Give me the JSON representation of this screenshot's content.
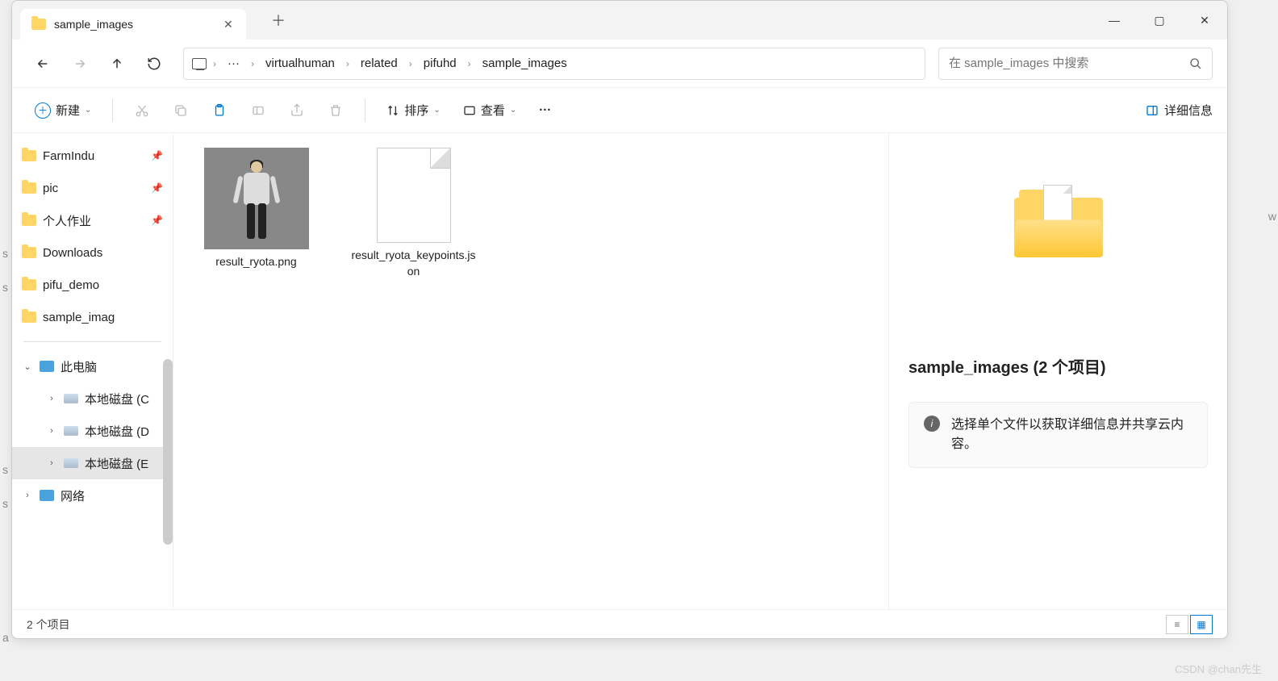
{
  "tab": {
    "title": "sample_images"
  },
  "window_controls": {
    "min": "—",
    "max": "▢",
    "close": "✕"
  },
  "breadcrumb": {
    "segments": [
      "virtualhuman",
      "related",
      "pifuhd",
      "sample_images"
    ],
    "ellipsis": "···"
  },
  "search": {
    "placeholder": "在 sample_images 中搜索"
  },
  "toolbar": {
    "new": "新建",
    "sort": "排序",
    "view": "查看",
    "more": "···",
    "details": "详细信息"
  },
  "sidebar": {
    "quick": [
      {
        "label": "FarmIndu",
        "pinned": true
      },
      {
        "label": "pic",
        "pinned": true
      },
      {
        "label": "个人作业",
        "pinned": true
      },
      {
        "label": "Downloads",
        "pinned": false
      },
      {
        "label": "pifu_demo",
        "pinned": false
      },
      {
        "label": "sample_imag",
        "pinned": false
      }
    ],
    "this_pc": "此电脑",
    "drives": [
      {
        "label": "本地磁盘 (C"
      },
      {
        "label": "本地磁盘 (D"
      },
      {
        "label": "本地磁盘 (E"
      }
    ],
    "network": "网络"
  },
  "files": [
    {
      "name": "result_ryota.png",
      "type": "image"
    },
    {
      "name": "result_ryota_keypoints.json",
      "type": "doc"
    }
  ],
  "details_pane": {
    "title": "sample_images (2 个项目)",
    "hint": "选择单个文件以获取详细信息并共享云内容。"
  },
  "statusbar": {
    "count": "2 个项目"
  },
  "watermark": "CSDN @chan先生",
  "peek": {
    "s1": "s",
    "s2": "s",
    "s3": "s",
    "s4": "s",
    "a": "a",
    "w": "w"
  }
}
